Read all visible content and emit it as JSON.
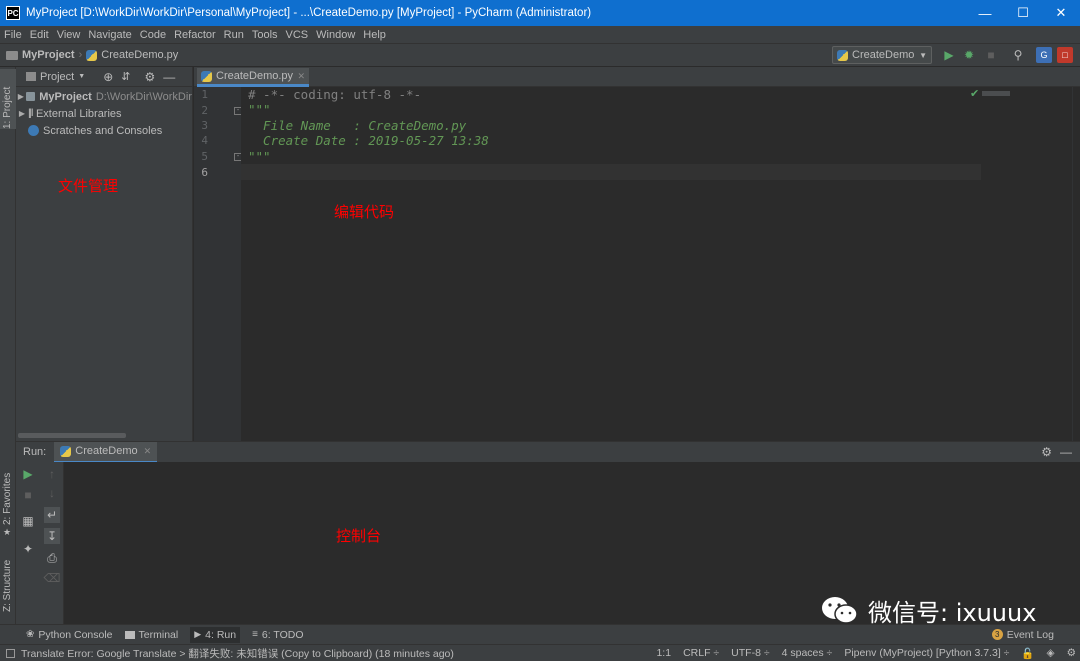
{
  "window": {
    "title": "MyProject [D:\\WorkDir\\WorkDir\\Personal\\MyProject] - ...\\CreateDemo.py [MyProject] - PyCharm (Administrator)",
    "app_icon": "PC"
  },
  "menu": [
    "File",
    "Edit",
    "View",
    "Navigate",
    "Code",
    "Refactor",
    "Run",
    "Tools",
    "VCS",
    "Window",
    "Help"
  ],
  "nav": {
    "project": "MyProject",
    "file": "CreateDemo.py",
    "run_config": "CreateDemo"
  },
  "project_panel": {
    "view_label": "Project",
    "stripe_label": "1: Project",
    "items": [
      {
        "label": "MyProject",
        "path": "D:\\WorkDir\\WorkDir"
      },
      {
        "label": "External Libraries"
      },
      {
        "label": "Scratches and Consoles"
      }
    ]
  },
  "editor": {
    "tab": "CreateDemo.py",
    "line_numbers": [
      "1",
      "2",
      "3",
      "4",
      "5",
      "6"
    ],
    "lines": [
      "# -*- coding: utf-8 -*-",
      "\"\"\"",
      "  File Name   : CreateDemo.py",
      "  Create Date : 2019-05-27 13:38",
      "\"\"\"",
      ""
    ]
  },
  "annotations": {
    "file_management": "文件管理",
    "edit_code": "编辑代码",
    "console": "控制台"
  },
  "run_panel": {
    "label": "Run:",
    "tab": "CreateDemo"
  },
  "left_stripe_bottom": [
    "2: Favorites",
    "Z: Structure"
  ],
  "bottom_tools": [
    {
      "label": "Python Console",
      "icon": "python-icon"
    },
    {
      "label": "Terminal",
      "icon": "terminal-icon"
    },
    {
      "label": "4: Run",
      "icon": "run-icon"
    },
    {
      "label": "6: TODO",
      "icon": "todo-icon"
    }
  ],
  "event_log": {
    "count": "3",
    "label": "Event Log"
  },
  "status": {
    "message": "Translate Error: Google Translate > 翻译失败: 未知错误 (Copy to Clipboard) (18 minutes ago)",
    "position": "1:1",
    "line_sep": "CRLF ÷",
    "encoding": "UTF-8 ÷",
    "indent": "4 spaces ÷",
    "interpreter": "Pipenv (MyProject) [Python 3.7.3] ÷"
  },
  "watermark": "微信号: ixuuux",
  "colors": {
    "title_bar": "#0f6fcf",
    "panel": "#3c3f41",
    "editor_bg": "#2b2b2b",
    "annotation": "#ff0000",
    "docstring": "#629755",
    "comment": "#808080"
  }
}
